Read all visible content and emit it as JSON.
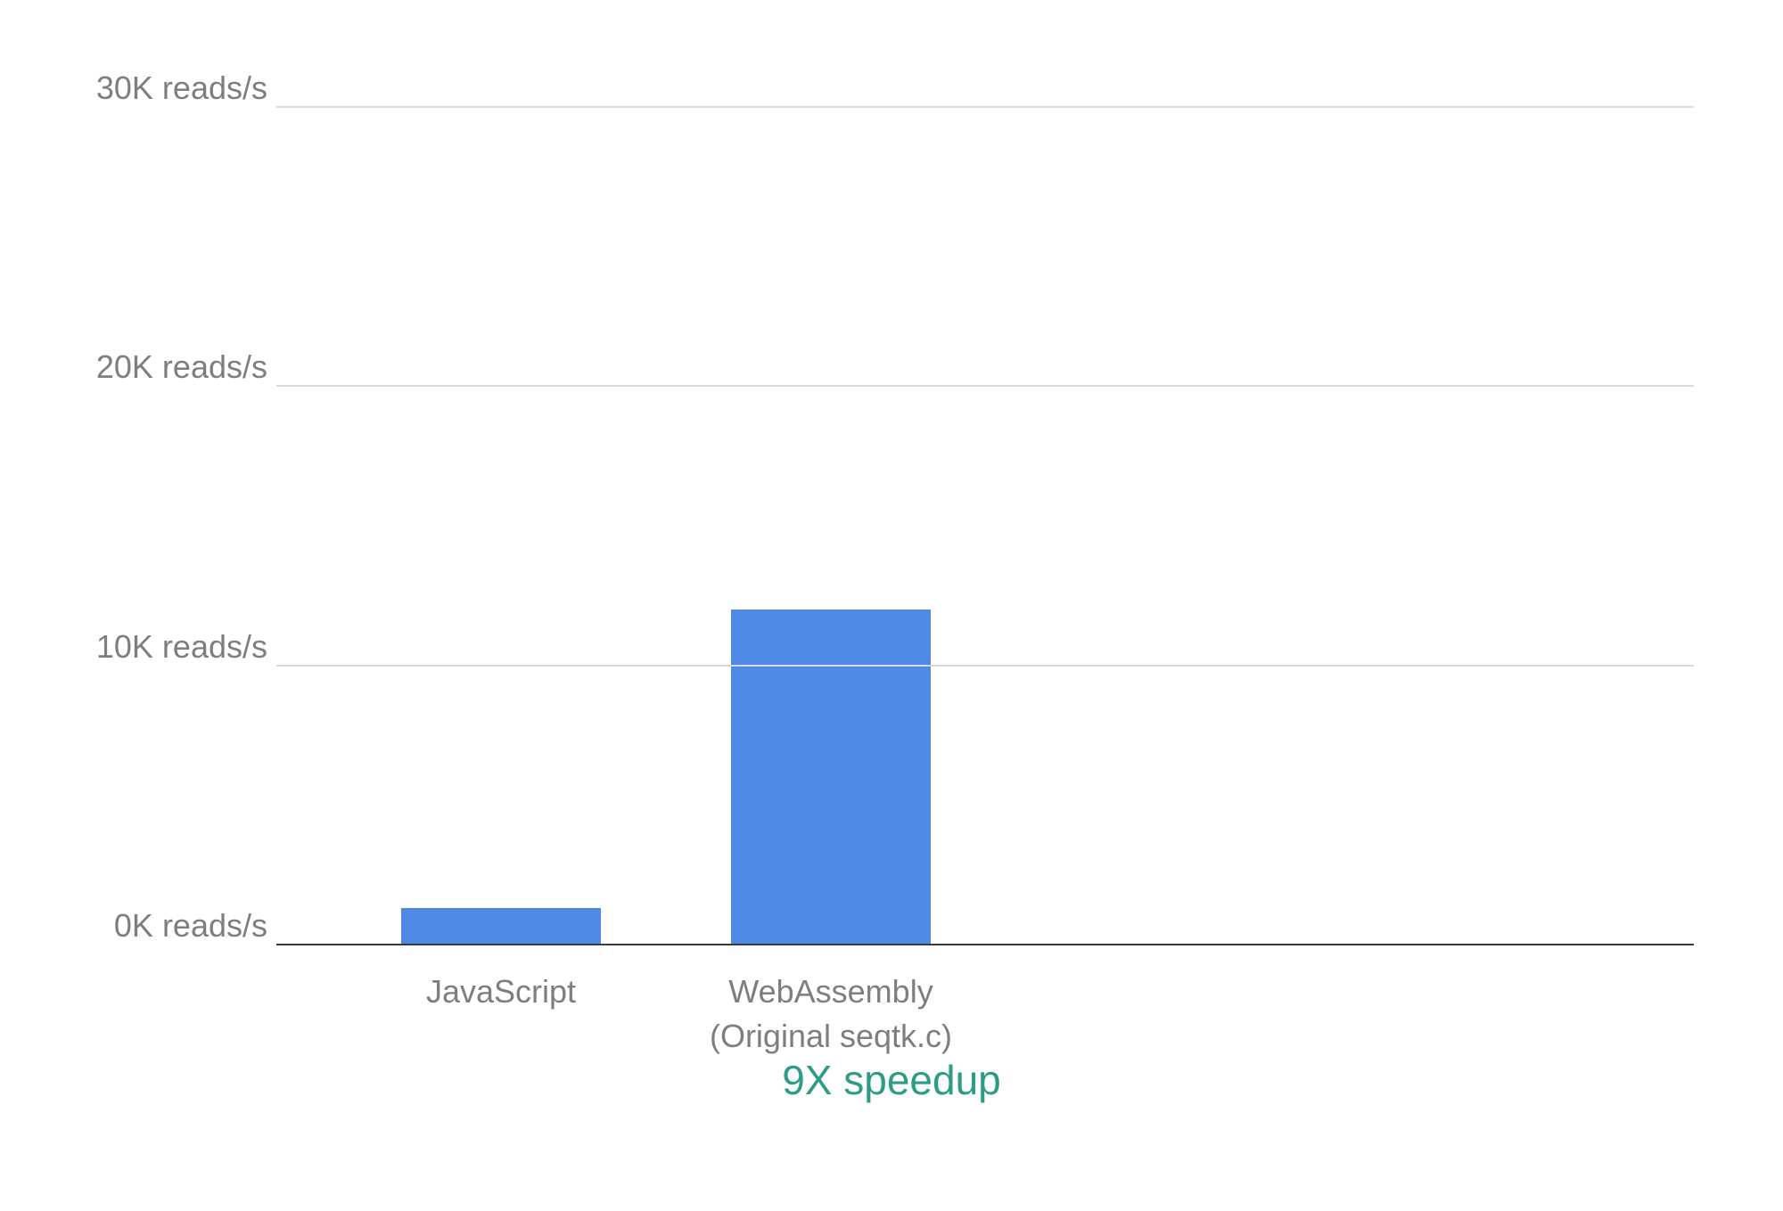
{
  "chart_data": {
    "type": "bar",
    "categories": [
      "JavaScript",
      "WebAssembly\n(Original seqtk.c)"
    ],
    "values": [
      1.3,
      12
    ],
    "title": "",
    "xlabel": "",
    "ylabel": "",
    "ylim": [
      0,
      30
    ],
    "ytick_labels": [
      "0K reads/s",
      "10K reads/s",
      "20K reads/s",
      "30K reads/s"
    ],
    "ytick_values": [
      0,
      10,
      20,
      30
    ],
    "bar_color": "#4e89e5",
    "caption": "9X speedup",
    "caption_color": "#2d9c87"
  }
}
